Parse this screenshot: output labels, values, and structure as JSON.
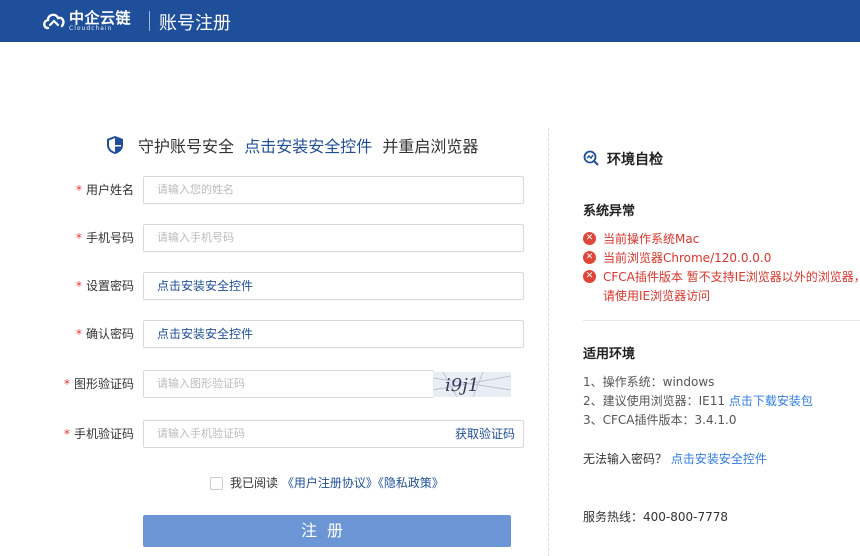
{
  "header": {
    "brand": "中企云链",
    "brand_sub": "Cloudchain",
    "page_title": "账号注册"
  },
  "notice": {
    "before": "守护账号安全",
    "link": "点击安装安全控件",
    "after": "并重启浏览器"
  },
  "form": {
    "name": {
      "label": "用户姓名",
      "placeholder": "请输入您的姓名"
    },
    "phone": {
      "label": "手机号码",
      "placeholder": "请输入手机号码"
    },
    "password": {
      "label": "设置密码",
      "value": "点击安装安全控件"
    },
    "confirm": {
      "label": "确认密码",
      "value": "点击安装安全控件"
    },
    "captcha": {
      "label": "图形验证码",
      "placeholder": "请输入图形验证码",
      "image_text": "i9j1"
    },
    "sms": {
      "label": "手机验证码",
      "placeholder": "请输入手机验证码",
      "get_code": "获取验证码"
    },
    "required_mark": "*",
    "agree": {
      "text": "我已阅读",
      "terms": "《用户注册协议》",
      "privacy": "《隐私政策》"
    },
    "submit": "注册"
  },
  "env": {
    "title": "环境自检",
    "abnormal_title": "系统异常",
    "errors": [
      "当前操作系统Mac",
      "当前浏览器Chrome/120.0.0.0",
      "CFCA插件版本 暂不支持IE浏览器以外的浏览器，",
      "请使用IE浏览器访问"
    ],
    "applicable_title": "适用环境",
    "req1": "1、操作系统：windows",
    "req2_prefix": "2、建议使用浏览器：IE11",
    "req2_link": "点击下载安装包",
    "req3": "3、CFCA插件版本：3.4.1.0",
    "no_input_prefix": "无法输入密码？",
    "no_input_link": "点击安装安全控件",
    "hotline": "服务热线：400-800-7778"
  },
  "colors": {
    "header": "#1f4f9a",
    "link": "#1f4f9a",
    "error": "#d9362b",
    "button": "#6b95d4"
  }
}
